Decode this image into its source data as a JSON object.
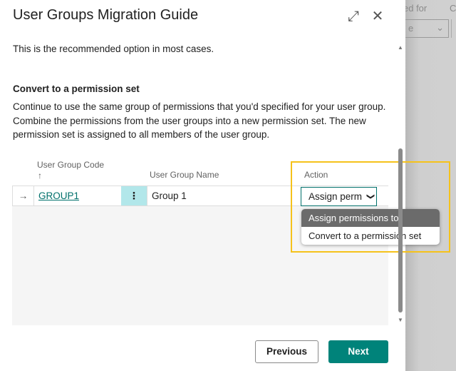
{
  "background": {
    "label": "ed for",
    "label2": "C",
    "select_value": "e"
  },
  "dialog": {
    "title": "User Groups Migration Guide",
    "expand_icon": "expand-icon",
    "close_icon": "close-icon",
    "intro": "This is the recommended option in most cases.",
    "section_title": "Convert to a permission set",
    "section_text": "Continue to use the same group of permissions that you'd specified for your user group. Combine the permissions from the user groups into a new permission set. The new permission set is assigned to all members of the user group.",
    "grid": {
      "columns": [
        "User Group Code",
        "User Group Name",
        "Action"
      ],
      "sort_indicator": "↑",
      "rows": [
        {
          "code": "GROUP1",
          "name": "Group 1",
          "action": "Assign perm"
        }
      ]
    },
    "action_dropdown": {
      "options": [
        "Assign permissions to members",
        "Convert to a permission set"
      ],
      "highlighted": "Assign permissions to members"
    },
    "buttons": {
      "previous": "Previous",
      "next": "Next"
    }
  },
  "colors": {
    "accent": "#00837a",
    "highlight_border": "#f5c21b",
    "selected_cell": "#b2e7ea"
  }
}
